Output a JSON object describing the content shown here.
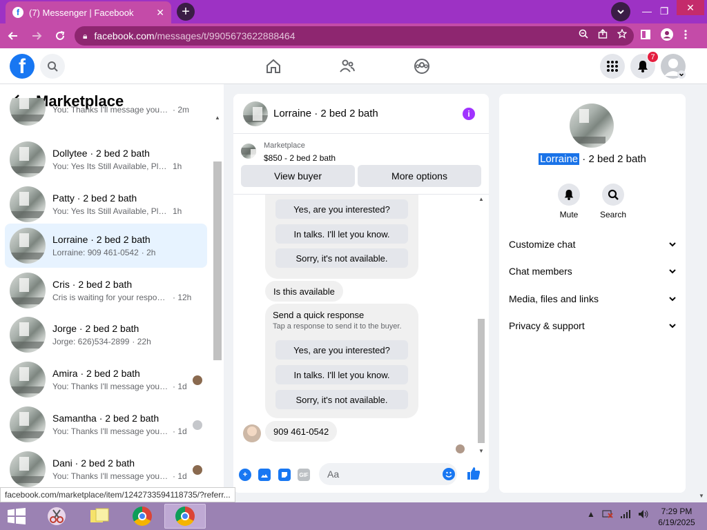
{
  "browser": {
    "tab_title": "(7) Messenger | Facebook",
    "tab_close": "✕",
    "new_tab": "+",
    "url_host": "facebook.com",
    "url_path": "/messages/t/9905673622888464",
    "status_url": "facebook.com/marketplace/item/1242733594118735/?referr..."
  },
  "fb": {
    "notification_count": "7"
  },
  "left": {
    "title": "Marketplace",
    "conversations": [
      {
        "name": "",
        "msg": "You: Thanks I'll message you in a ...",
        "time": "· 2m"
      },
      {
        "name": "Dollytee · 2 bed 2 bath",
        "msg": "You: Yes Its Still Available, Please S...",
        "time": "1h"
      },
      {
        "name": "Patty · 2 bed 2 bath",
        "msg": "You: Yes Its Still Available, Please S...",
        "time": "1h"
      },
      {
        "name": "Lorraine · 2 bed 2 bath",
        "msg": "Lorraine: 909 461-0542",
        "time": "· 2h"
      },
      {
        "name": "Cris · 2 bed 2 bath",
        "msg": "Cris is waiting for your response.",
        "time": "· 12h"
      },
      {
        "name": "Jorge · 2 bed 2 bath",
        "msg": "Jorge: 626)534-2899",
        "time": "· 22h"
      },
      {
        "name": "Amira · 2 bed 2 bath",
        "msg": "You: Thanks I'll message you in ...",
        "time": "· 1d"
      },
      {
        "name": "Samantha · 2 bed 2 bath",
        "msg": "You: Thanks I'll message you in ...",
        "time": "· 1d"
      },
      {
        "name": "Dani · 2 bed 2 bath",
        "msg": "You: Thanks I'll message you in ...",
        "time": "· 1d"
      }
    ]
  },
  "chat": {
    "header_name": "Lorraine · 2 bed 2 bath",
    "listing_category": "Marketplace",
    "listing_price": "$850 - 2 bed 2 bath",
    "view_buyer": "View buyer",
    "more_options": "More options",
    "quick_reply_title": "Send a quick response",
    "quick_reply_sub": "Tap a response to send it to the buyer.",
    "qr1": "Yes, are you interested?",
    "qr2": "In talks. I'll let you know.",
    "qr3": "Sorry, it's not available.",
    "is_available": "Is this available",
    "phone_msg": "909 461-0542",
    "placeholder": "Aa",
    "gif": "GIF"
  },
  "right": {
    "name_highlight": "Lorraine",
    "name_rest": " · 2 bed 2 bath",
    "mute": "Mute",
    "search": "Search",
    "items": [
      "Customize chat",
      "Chat members",
      "Media, files and links",
      "Privacy & support"
    ]
  },
  "taskbar": {
    "time": "7:29 PM",
    "date": "6/19/2025"
  },
  "colors": {
    "chrome_frame": "#9d32c4",
    "fb_blue": "#1877f2",
    "active_conv": "#e7f3ff"
  }
}
